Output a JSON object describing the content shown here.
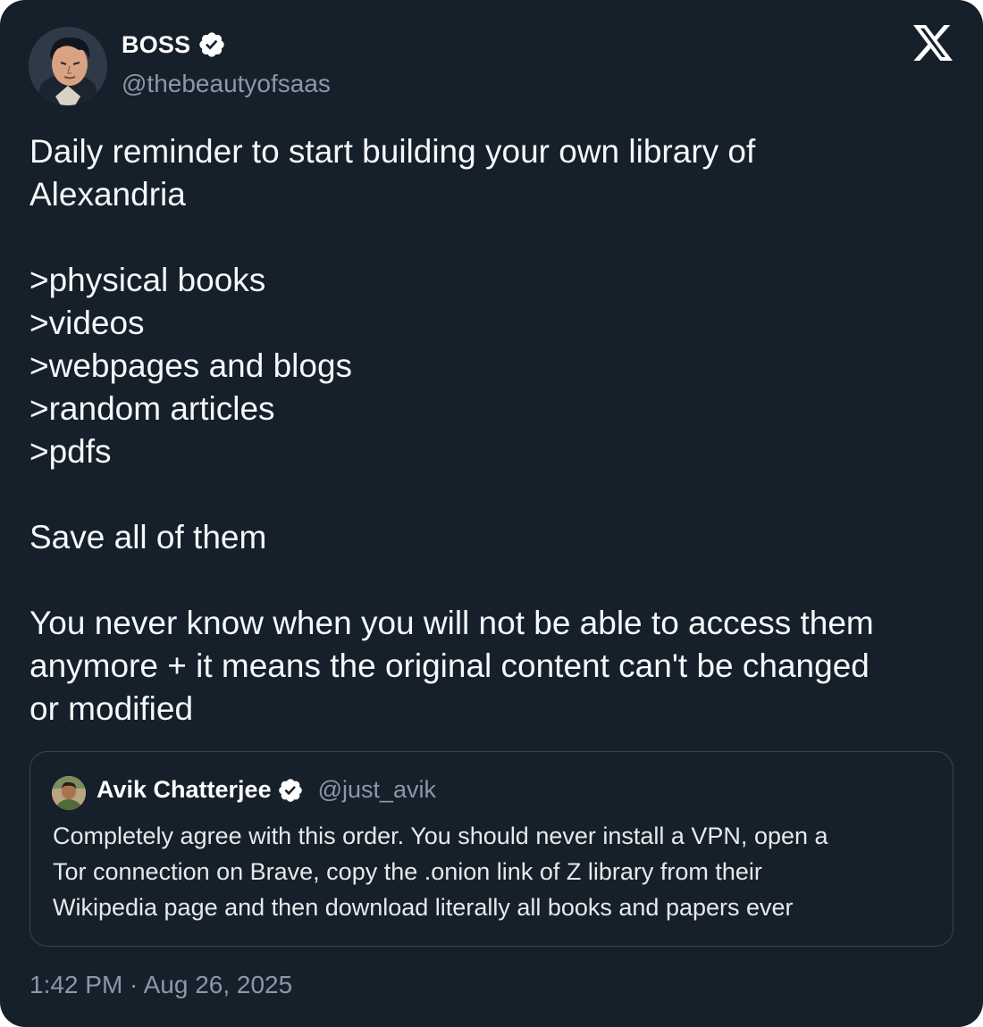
{
  "author": {
    "name": "BOSS",
    "handle": "@thebeautyofsaas",
    "verified": true
  },
  "brand_icon": "x-logo-icon",
  "tweet": {
    "lines": [
      "Daily reminder to start building your own library of",
      "Alexandria",
      "",
      ">physical books",
      ">videos",
      ">webpages and blogs",
      ">random articles",
      ">pdfs",
      "",
      "Save all of them",
      "",
      "You never know when you will not be able to access them",
      "anymore + it means the original content can't be changed",
      "or modified"
    ]
  },
  "quoted_tweet": {
    "name": "Avik Chatterjee",
    "handle": "@just_avik",
    "verified": true,
    "lines": [
      "Completely agree with this order. You should never install a VPN, open a",
      "Tor connection on Brave, copy the .onion link of Z library from their",
      "Wikipedia page and then download literally all books and papers ever"
    ]
  },
  "timestamp": "1:42 PM · Aug 26, 2025",
  "colors": {
    "background": "#15202b",
    "text": "#f5f8fa",
    "muted": "#8b98a5",
    "border": "#3a4652",
    "verified_badge": "#ffffff"
  }
}
